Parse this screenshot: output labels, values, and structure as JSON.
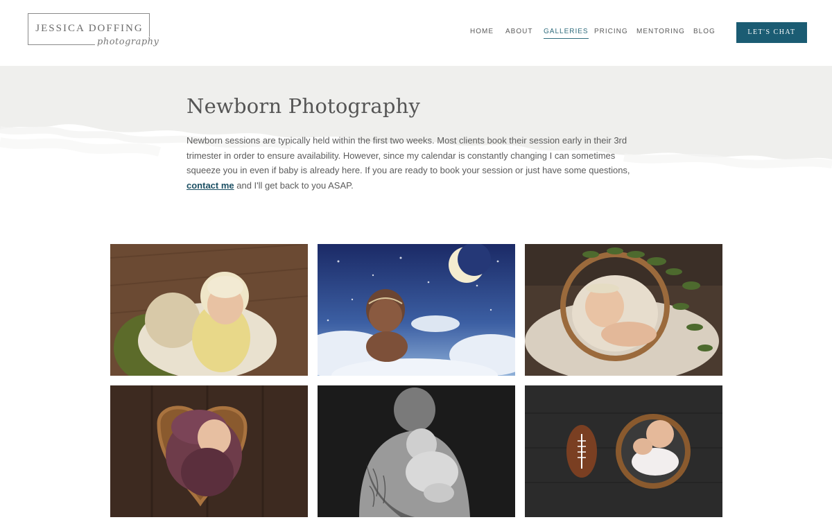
{
  "brand": {
    "name": "JESSICA DOFFING",
    "script": "photography"
  },
  "nav": {
    "items": [
      {
        "label": "HOME",
        "active": false
      },
      {
        "label": "ABOUT",
        "active": false
      },
      {
        "label": "GALLERIES",
        "active": true
      },
      {
        "label": "PRICING",
        "active": false
      },
      {
        "label": "MENTORING",
        "active": false
      },
      {
        "label": "BLOG",
        "active": false
      }
    ],
    "cta_label": "LET'S CHAT"
  },
  "hero": {
    "title": "Newborn Photography",
    "text_before": "Newborn sessions are typically held within the first two weeks. Most clients book their session early in their 3rd trimester in order to ensure availability. However, since my calendar is constantly changing I can sometimes squeeze you in even if baby is already here. If you are ready to book your session or just have some questions, ",
    "link_label": "contact me",
    "text_after": " and I'll get back to you ASAP."
  },
  "gallery": {
    "photos": [
      {
        "name": "photo-baby-yellow-wrap"
      },
      {
        "name": "photo-baby-moon-clouds"
      },
      {
        "name": "photo-baby-basket-greenery"
      },
      {
        "name": "photo-baby-heart-bowl"
      },
      {
        "name": "photo-father-holding-baby"
      },
      {
        "name": "photo-baby-football-bowl"
      }
    ]
  },
  "colors": {
    "accent": "#1b5c73",
    "hero_band": "#efefed",
    "link": "#1b4f63"
  }
}
